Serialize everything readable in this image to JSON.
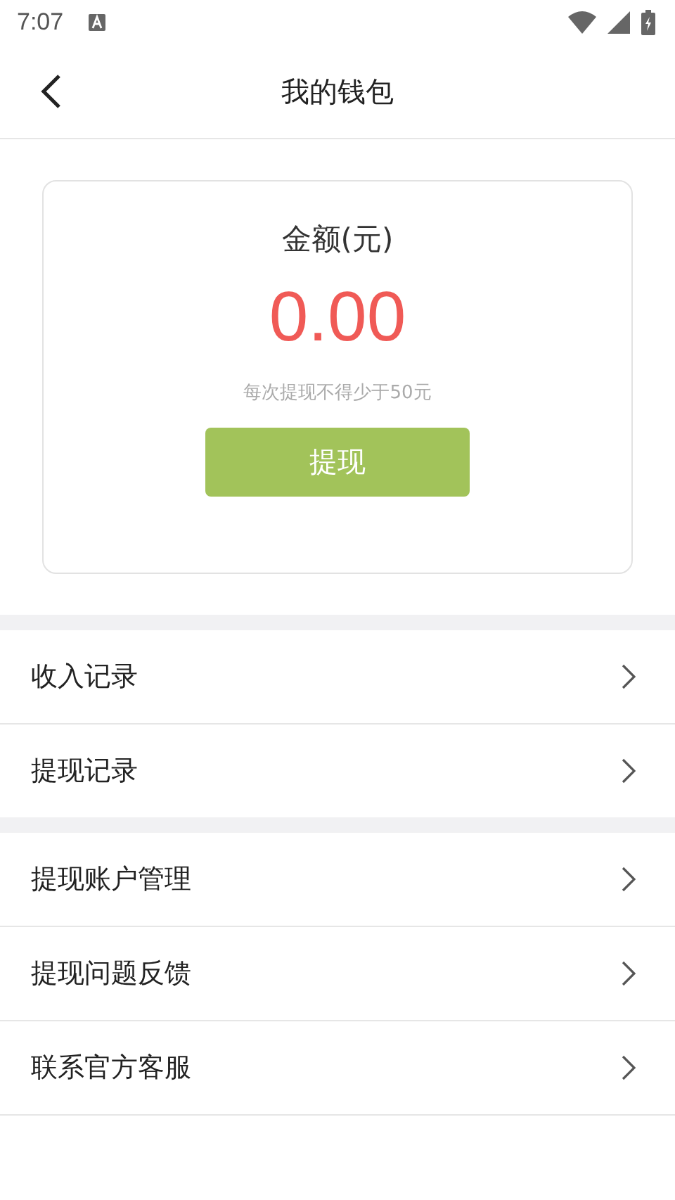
{
  "status_bar": {
    "time": "7:07"
  },
  "header": {
    "title": "我的钱包"
  },
  "wallet": {
    "label": "金额(元)",
    "amount": "0.00",
    "note": "每次提现不得少于50元",
    "button": "提现"
  },
  "menu_groups": [
    {
      "items": [
        {
          "label": "收入记录"
        },
        {
          "label": "提现记录"
        }
      ]
    },
    {
      "items": [
        {
          "label": "提现账户管理"
        },
        {
          "label": "提现问题反馈"
        },
        {
          "label": "联系官方客服"
        }
      ]
    }
  ]
}
